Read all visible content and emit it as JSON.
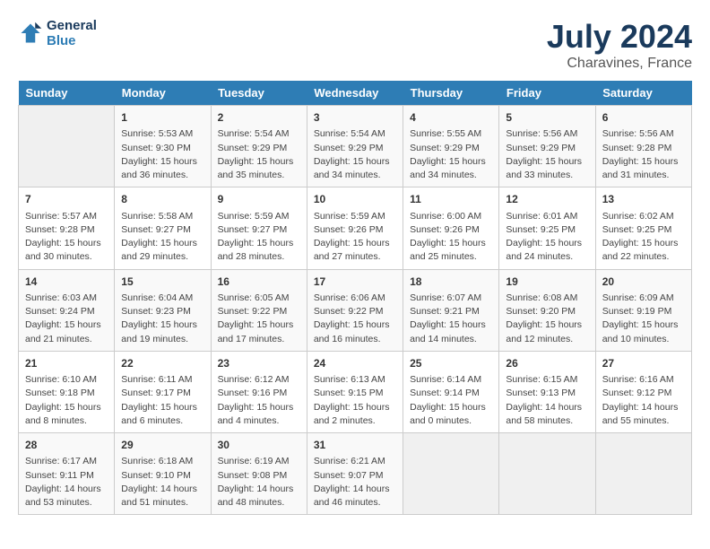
{
  "header": {
    "logo_line1": "General",
    "logo_line2": "Blue",
    "month_year": "July 2024",
    "location": "Charavines, France"
  },
  "weekdays": [
    "Sunday",
    "Monday",
    "Tuesday",
    "Wednesday",
    "Thursday",
    "Friday",
    "Saturday"
  ],
  "weeks": [
    [
      {
        "day": "",
        "empty": true
      },
      {
        "day": "1",
        "sunrise": "Sunrise: 5:53 AM",
        "sunset": "Sunset: 9:30 PM",
        "daylight": "Daylight: 15 hours and 36 minutes."
      },
      {
        "day": "2",
        "sunrise": "Sunrise: 5:54 AM",
        "sunset": "Sunset: 9:29 PM",
        "daylight": "Daylight: 15 hours and 35 minutes."
      },
      {
        "day": "3",
        "sunrise": "Sunrise: 5:54 AM",
        "sunset": "Sunset: 9:29 PM",
        "daylight": "Daylight: 15 hours and 34 minutes."
      },
      {
        "day": "4",
        "sunrise": "Sunrise: 5:55 AM",
        "sunset": "Sunset: 9:29 PM",
        "daylight": "Daylight: 15 hours and 34 minutes."
      },
      {
        "day": "5",
        "sunrise": "Sunrise: 5:56 AM",
        "sunset": "Sunset: 9:29 PM",
        "daylight": "Daylight: 15 hours and 33 minutes."
      },
      {
        "day": "6",
        "sunrise": "Sunrise: 5:56 AM",
        "sunset": "Sunset: 9:28 PM",
        "daylight": "Daylight: 15 hours and 31 minutes."
      }
    ],
    [
      {
        "day": "7",
        "sunrise": "Sunrise: 5:57 AM",
        "sunset": "Sunset: 9:28 PM",
        "daylight": "Daylight: 15 hours and 30 minutes."
      },
      {
        "day": "8",
        "sunrise": "Sunrise: 5:58 AM",
        "sunset": "Sunset: 9:27 PM",
        "daylight": "Daylight: 15 hours and 29 minutes."
      },
      {
        "day": "9",
        "sunrise": "Sunrise: 5:59 AM",
        "sunset": "Sunset: 9:27 PM",
        "daylight": "Daylight: 15 hours and 28 minutes."
      },
      {
        "day": "10",
        "sunrise": "Sunrise: 5:59 AM",
        "sunset": "Sunset: 9:26 PM",
        "daylight": "Daylight: 15 hours and 27 minutes."
      },
      {
        "day": "11",
        "sunrise": "Sunrise: 6:00 AM",
        "sunset": "Sunset: 9:26 PM",
        "daylight": "Daylight: 15 hours and 25 minutes."
      },
      {
        "day": "12",
        "sunrise": "Sunrise: 6:01 AM",
        "sunset": "Sunset: 9:25 PM",
        "daylight": "Daylight: 15 hours and 24 minutes."
      },
      {
        "day": "13",
        "sunrise": "Sunrise: 6:02 AM",
        "sunset": "Sunset: 9:25 PM",
        "daylight": "Daylight: 15 hours and 22 minutes."
      }
    ],
    [
      {
        "day": "14",
        "sunrise": "Sunrise: 6:03 AM",
        "sunset": "Sunset: 9:24 PM",
        "daylight": "Daylight: 15 hours and 21 minutes."
      },
      {
        "day": "15",
        "sunrise": "Sunrise: 6:04 AM",
        "sunset": "Sunset: 9:23 PM",
        "daylight": "Daylight: 15 hours and 19 minutes."
      },
      {
        "day": "16",
        "sunrise": "Sunrise: 6:05 AM",
        "sunset": "Sunset: 9:22 PM",
        "daylight": "Daylight: 15 hours and 17 minutes."
      },
      {
        "day": "17",
        "sunrise": "Sunrise: 6:06 AM",
        "sunset": "Sunset: 9:22 PM",
        "daylight": "Daylight: 15 hours and 16 minutes."
      },
      {
        "day": "18",
        "sunrise": "Sunrise: 6:07 AM",
        "sunset": "Sunset: 9:21 PM",
        "daylight": "Daylight: 15 hours and 14 minutes."
      },
      {
        "day": "19",
        "sunrise": "Sunrise: 6:08 AM",
        "sunset": "Sunset: 9:20 PM",
        "daylight": "Daylight: 15 hours and 12 minutes."
      },
      {
        "day": "20",
        "sunrise": "Sunrise: 6:09 AM",
        "sunset": "Sunset: 9:19 PM",
        "daylight": "Daylight: 15 hours and 10 minutes."
      }
    ],
    [
      {
        "day": "21",
        "sunrise": "Sunrise: 6:10 AM",
        "sunset": "Sunset: 9:18 PM",
        "daylight": "Daylight: 15 hours and 8 minutes."
      },
      {
        "day": "22",
        "sunrise": "Sunrise: 6:11 AM",
        "sunset": "Sunset: 9:17 PM",
        "daylight": "Daylight: 15 hours and 6 minutes."
      },
      {
        "day": "23",
        "sunrise": "Sunrise: 6:12 AM",
        "sunset": "Sunset: 9:16 PM",
        "daylight": "Daylight: 15 hours and 4 minutes."
      },
      {
        "day": "24",
        "sunrise": "Sunrise: 6:13 AM",
        "sunset": "Sunset: 9:15 PM",
        "daylight": "Daylight: 15 hours and 2 minutes."
      },
      {
        "day": "25",
        "sunrise": "Sunrise: 6:14 AM",
        "sunset": "Sunset: 9:14 PM",
        "daylight": "Daylight: 15 hours and 0 minutes."
      },
      {
        "day": "26",
        "sunrise": "Sunrise: 6:15 AM",
        "sunset": "Sunset: 9:13 PM",
        "daylight": "Daylight: 14 hours and 58 minutes."
      },
      {
        "day": "27",
        "sunrise": "Sunrise: 6:16 AM",
        "sunset": "Sunset: 9:12 PM",
        "daylight": "Daylight: 14 hours and 55 minutes."
      }
    ],
    [
      {
        "day": "28",
        "sunrise": "Sunrise: 6:17 AM",
        "sunset": "Sunset: 9:11 PM",
        "daylight": "Daylight: 14 hours and 53 minutes."
      },
      {
        "day": "29",
        "sunrise": "Sunrise: 6:18 AM",
        "sunset": "Sunset: 9:10 PM",
        "daylight": "Daylight: 14 hours and 51 minutes."
      },
      {
        "day": "30",
        "sunrise": "Sunrise: 6:19 AM",
        "sunset": "Sunset: 9:08 PM",
        "daylight": "Daylight: 14 hours and 48 minutes."
      },
      {
        "day": "31",
        "sunrise": "Sunrise: 6:21 AM",
        "sunset": "Sunset: 9:07 PM",
        "daylight": "Daylight: 14 hours and 46 minutes."
      },
      {
        "day": "",
        "empty": true
      },
      {
        "day": "",
        "empty": true
      },
      {
        "day": "",
        "empty": true
      }
    ]
  ]
}
